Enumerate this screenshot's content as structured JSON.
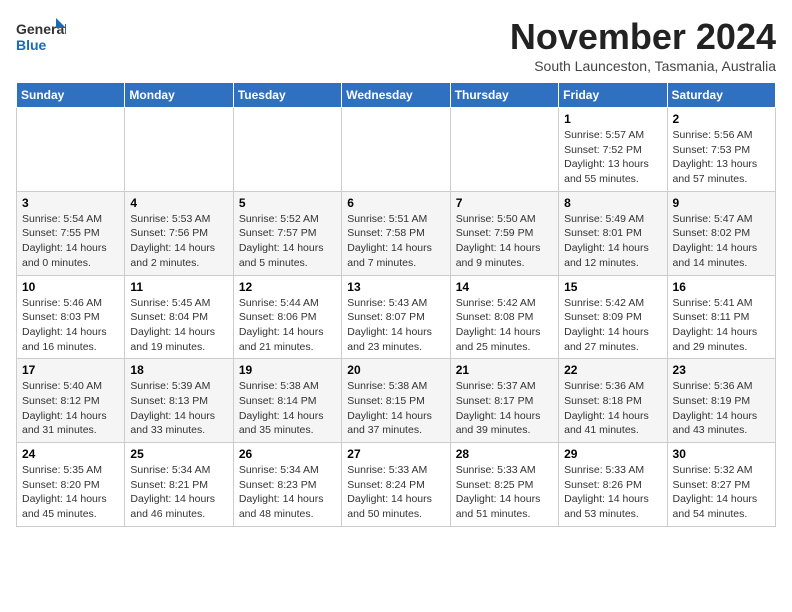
{
  "logo": {
    "general": "General",
    "blue": "Blue"
  },
  "header": {
    "month": "November 2024",
    "location": "South Launceston, Tasmania, Australia"
  },
  "weekdays": [
    "Sunday",
    "Monday",
    "Tuesday",
    "Wednesday",
    "Thursday",
    "Friday",
    "Saturday"
  ],
  "weeks": [
    [
      {
        "day": "",
        "info": ""
      },
      {
        "day": "",
        "info": ""
      },
      {
        "day": "",
        "info": ""
      },
      {
        "day": "",
        "info": ""
      },
      {
        "day": "",
        "info": ""
      },
      {
        "day": "1",
        "info": "Sunrise: 5:57 AM\nSunset: 7:52 PM\nDaylight: 13 hours and 55 minutes."
      },
      {
        "day": "2",
        "info": "Sunrise: 5:56 AM\nSunset: 7:53 PM\nDaylight: 13 hours and 57 minutes."
      }
    ],
    [
      {
        "day": "3",
        "info": "Sunrise: 5:54 AM\nSunset: 7:55 PM\nDaylight: 14 hours and 0 minutes."
      },
      {
        "day": "4",
        "info": "Sunrise: 5:53 AM\nSunset: 7:56 PM\nDaylight: 14 hours and 2 minutes."
      },
      {
        "day": "5",
        "info": "Sunrise: 5:52 AM\nSunset: 7:57 PM\nDaylight: 14 hours and 5 minutes."
      },
      {
        "day": "6",
        "info": "Sunrise: 5:51 AM\nSunset: 7:58 PM\nDaylight: 14 hours and 7 minutes."
      },
      {
        "day": "7",
        "info": "Sunrise: 5:50 AM\nSunset: 7:59 PM\nDaylight: 14 hours and 9 minutes."
      },
      {
        "day": "8",
        "info": "Sunrise: 5:49 AM\nSunset: 8:01 PM\nDaylight: 14 hours and 12 minutes."
      },
      {
        "day": "9",
        "info": "Sunrise: 5:47 AM\nSunset: 8:02 PM\nDaylight: 14 hours and 14 minutes."
      }
    ],
    [
      {
        "day": "10",
        "info": "Sunrise: 5:46 AM\nSunset: 8:03 PM\nDaylight: 14 hours and 16 minutes."
      },
      {
        "day": "11",
        "info": "Sunrise: 5:45 AM\nSunset: 8:04 PM\nDaylight: 14 hours and 19 minutes."
      },
      {
        "day": "12",
        "info": "Sunrise: 5:44 AM\nSunset: 8:06 PM\nDaylight: 14 hours and 21 minutes."
      },
      {
        "day": "13",
        "info": "Sunrise: 5:43 AM\nSunset: 8:07 PM\nDaylight: 14 hours and 23 minutes."
      },
      {
        "day": "14",
        "info": "Sunrise: 5:42 AM\nSunset: 8:08 PM\nDaylight: 14 hours and 25 minutes."
      },
      {
        "day": "15",
        "info": "Sunrise: 5:42 AM\nSunset: 8:09 PM\nDaylight: 14 hours and 27 minutes."
      },
      {
        "day": "16",
        "info": "Sunrise: 5:41 AM\nSunset: 8:11 PM\nDaylight: 14 hours and 29 minutes."
      }
    ],
    [
      {
        "day": "17",
        "info": "Sunrise: 5:40 AM\nSunset: 8:12 PM\nDaylight: 14 hours and 31 minutes."
      },
      {
        "day": "18",
        "info": "Sunrise: 5:39 AM\nSunset: 8:13 PM\nDaylight: 14 hours and 33 minutes."
      },
      {
        "day": "19",
        "info": "Sunrise: 5:38 AM\nSunset: 8:14 PM\nDaylight: 14 hours and 35 minutes."
      },
      {
        "day": "20",
        "info": "Sunrise: 5:38 AM\nSunset: 8:15 PM\nDaylight: 14 hours and 37 minutes."
      },
      {
        "day": "21",
        "info": "Sunrise: 5:37 AM\nSunset: 8:17 PM\nDaylight: 14 hours and 39 minutes."
      },
      {
        "day": "22",
        "info": "Sunrise: 5:36 AM\nSunset: 8:18 PM\nDaylight: 14 hours and 41 minutes."
      },
      {
        "day": "23",
        "info": "Sunrise: 5:36 AM\nSunset: 8:19 PM\nDaylight: 14 hours and 43 minutes."
      }
    ],
    [
      {
        "day": "24",
        "info": "Sunrise: 5:35 AM\nSunset: 8:20 PM\nDaylight: 14 hours and 45 minutes."
      },
      {
        "day": "25",
        "info": "Sunrise: 5:34 AM\nSunset: 8:21 PM\nDaylight: 14 hours and 46 minutes."
      },
      {
        "day": "26",
        "info": "Sunrise: 5:34 AM\nSunset: 8:23 PM\nDaylight: 14 hours and 48 minutes."
      },
      {
        "day": "27",
        "info": "Sunrise: 5:33 AM\nSunset: 8:24 PM\nDaylight: 14 hours and 50 minutes."
      },
      {
        "day": "28",
        "info": "Sunrise: 5:33 AM\nSunset: 8:25 PM\nDaylight: 14 hours and 51 minutes."
      },
      {
        "day": "29",
        "info": "Sunrise: 5:33 AM\nSunset: 8:26 PM\nDaylight: 14 hours and 53 minutes."
      },
      {
        "day": "30",
        "info": "Sunrise: 5:32 AM\nSunset: 8:27 PM\nDaylight: 14 hours and 54 minutes."
      }
    ]
  ]
}
